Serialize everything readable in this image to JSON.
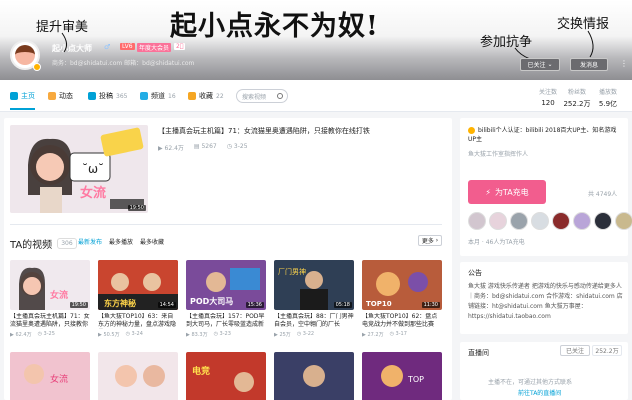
{
  "meme": {
    "headline": "起小点永不为奴!",
    "left_caption": "提升审美",
    "right_caption_1": "参加抗争",
    "right_caption_2": "交换情报"
  },
  "profile": {
    "username": "起小点大师",
    "sex": "♂",
    "level": "LV6",
    "vip": "年度大会员",
    "year_badge": "2⃣",
    "sign": "商务：bd@shidatui.com 邮箱：bd@shidatui.com",
    "follow_state": "已关注",
    "message_label": "发消息"
  },
  "nav": {
    "tabs": [
      {
        "label": "主页",
        "count": ""
      },
      {
        "label": "动态",
        "count": ""
      },
      {
        "label": "投稿",
        "count": "365"
      },
      {
        "label": "频道",
        "count": "16"
      },
      {
        "label": "收藏",
        "count": "22"
      }
    ],
    "search_placeholder": "搜索视频",
    "stats": [
      {
        "label": "关注数",
        "value": "120"
      },
      {
        "label": "粉丝数",
        "value": "252.2万"
      },
      {
        "label": "播放数",
        "value": "5.9亿"
      }
    ]
  },
  "featured": {
    "title": "【主播真会玩主机篇】71：女流猫里奥遭遇陷阱，只接教你在线打铁",
    "plays": "62.4万",
    "danmaku": "5267",
    "date": "3-25"
  },
  "videos_section": {
    "title": "TA的视频",
    "count": "306",
    "sort": [
      "最新发布",
      "最多播放",
      "最多收藏"
    ],
    "more": "更多"
  },
  "videos": [
    {
      "title": "【主播真会玩主机篇】71：女流猫里奥遭遇陷阱，只接教你",
      "duration": "19:50",
      "plays": "62.4万",
      "date": "3-25"
    },
    {
      "title": "【鱼大拔TOP10】63：来自东方的神秘力量，盘点游戏隐藏",
      "duration": "14:54",
      "plays": "50.5万",
      "date": "3-24"
    },
    {
      "title": "【主播真会玩】157：POD早到大司马，厂长零吸蓝造成新",
      "duration": "15:36",
      "plays": "83.3万",
      "date": "3-23"
    },
    {
      "title": "【主播真会玩】88：厂门男神自会员，空中翱门的厂长",
      "duration": "05:18",
      "plays": "25万",
      "date": "3-22"
    },
    {
      "title": "【鱼大拔TOP10】62：盘点电竞战力并不做到那些比赛",
      "duration": "11:30",
      "plays": "27.2万",
      "date": "3-17"
    },
    {
      "title": "",
      "duration": "",
      "plays": "",
      "date": ""
    },
    {
      "title": "",
      "duration": "",
      "plays": "",
      "date": ""
    },
    {
      "title": "",
      "duration": "",
      "plays": "",
      "date": ""
    },
    {
      "title": "",
      "duration": "",
      "plays": "",
      "date": ""
    },
    {
      "title": "",
      "duration": "",
      "plays": "",
      "date": ""
    }
  ],
  "sidebar": {
    "cert": "bilibili个人认证：bilibili 2018百大UP主、知名游戏UP主",
    "cert2": "鱼大拔工作室指挥作人",
    "charge_label": "为TA充电",
    "charge_count": "共 4749人",
    "charge_note": "本月 · 46人为TA充电",
    "notice_title": "公告",
    "notice_body": "鱼大拔 游戏快乐传递者 把游戏的快乐与感动传递给更多人｜商务：bd@shidatui.com 合作游戏：shidatui.com 店铺链接：ht@shidatui.com 鱼大拔万事屋：https://shidatui.taobao.com",
    "live_title": "直播间",
    "live_followed": "已关注",
    "live_count": "252.2万",
    "live_offline": "主播不在，可通过其他方式联系",
    "live_link": "前往TA的直播间"
  },
  "colors": {
    "accent": "#00a1d6",
    "pink": "#f25d8e"
  }
}
